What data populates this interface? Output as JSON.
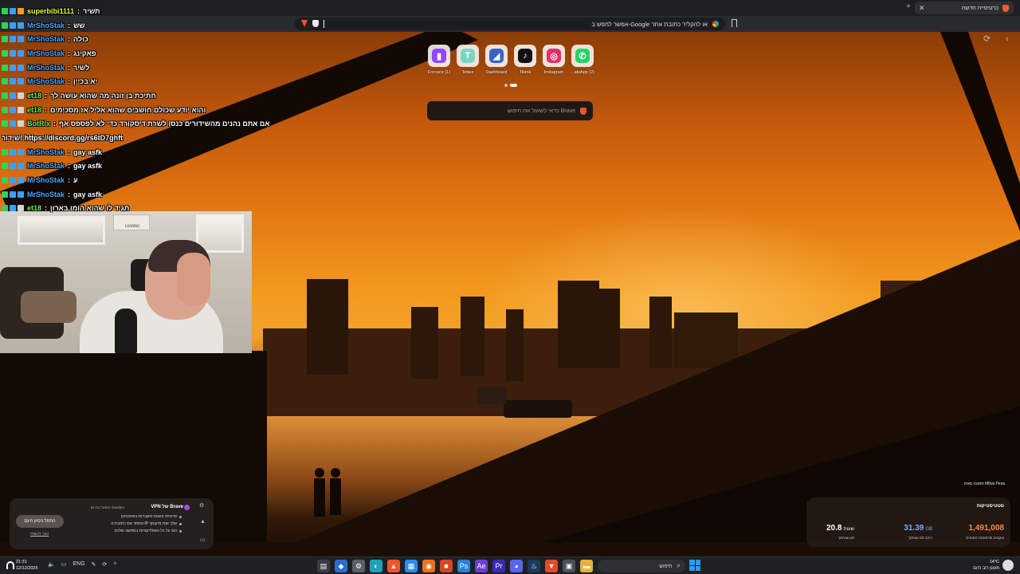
{
  "browser": {
    "tab_title": "כרטיסייה חדשה",
    "address_placeholder": "אפשר לחפש ב-Google או להקליד כתובת אתר"
  },
  "speed_dial": [
    {
      "label": "Forcece (1)",
      "icon": "twitch-icon",
      "color": "#9146ff",
      "glyph": "▮"
    },
    {
      "label": "Tebex",
      "icon": "tebex-icon",
      "color": "#7fd3c4",
      "glyph": "T"
    },
    {
      "label": "Dashboard",
      "icon": "dashboard-icon",
      "color": "#3a63c8",
      "glyph": "◢"
    },
    {
      "label": "Tiktok",
      "icon": "tiktok-icon",
      "color": "#111111",
      "glyph": "♪"
    },
    {
      "label": "Instagram",
      "icon": "instagram-icon",
      "color": "#e1306c",
      "glyph": "◎"
    },
    {
      "label": "...atsApp (2)",
      "icon": "whatsapp-icon",
      "color": "#25d366",
      "glyph": "✆"
    }
  ],
  "ai_search_placeholder": "כדאי לשאול את חיפוש Brave",
  "chat": [
    {
      "user": "superbibi1111",
      "user_class": "yellow",
      "msg": "תשיר",
      "badges": [
        "green",
        "blue",
        "orange"
      ]
    },
    {
      "user": "MrShoStak",
      "user_class": "",
      "msg": "שש",
      "badges": [
        "green",
        "blue",
        "blue"
      ]
    },
    {
      "user": "MrShoStak",
      "user_class": "",
      "msg": "כולה",
      "badges": [
        "green",
        "blue",
        "blue"
      ]
    },
    {
      "user": "MrShoStak",
      "user_class": "",
      "msg": "פאקינג",
      "badges": [
        "green",
        "blue",
        "blue"
      ]
    },
    {
      "user": "MrShoStak",
      "user_class": "",
      "msg": "לשיר",
      "badges": [
        "green",
        "blue",
        "blue"
      ]
    },
    {
      "user": "MrShoStak",
      "user_class": "",
      "msg": "יא בכיין",
      "badges": [
        "green",
        "blue",
        "blue"
      ]
    },
    {
      "user": "et18",
      "user_class": "bot",
      "msg": "חתיכת בן זונה מה שהוא עושה לך",
      "badges": [
        "green",
        "blue",
        "gray"
      ]
    },
    {
      "user": "et18",
      "user_class": "bot",
      "msg": "והוא יודע שכולם חושבים שהוא אליל אז מסכימים",
      "badges": [
        "green",
        "blue",
        "gray"
      ]
    },
    {
      "user": "BotRix",
      "user_class": "bot",
      "msg": "אם אתם נהנים מהשידורים כנסו לשרת דיסקורד כדי לא לפספס אף",
      "badges": [
        "green",
        "blue",
        "gray"
      ]
    },
    {
      "user": "",
      "user_class": "",
      "msg": "שידור! https://discord.gg/rs6tD7ghft",
      "badges": []
    },
    {
      "user": "MrShoStak",
      "user_class": "",
      "msg": "gay asfk",
      "badges": [
        "green",
        "blue",
        "blue"
      ]
    },
    {
      "user": "MrShoStak",
      "user_class": "",
      "msg": "gay asfk",
      "badges": [
        "green",
        "blue",
        "blue"
      ]
    },
    {
      "user": "MrShoStak",
      "user_class": "",
      "msg": "ע",
      "badges": [
        "green",
        "blue",
        "blue"
      ]
    },
    {
      "user": "MrShoStak",
      "user_class": "",
      "msg": "gay asfk",
      "badges": [
        "green",
        "blue",
        "blue"
      ]
    },
    {
      "user": "et18",
      "user_class": "bot",
      "msg": "תגיד לו שהוא הומו בארון",
      "badges": [
        "green",
        "blue",
        "gray"
      ]
    }
  ],
  "webcam": {
    "sign_text": "LOADING"
  },
  "vpn_card": {
    "title": "VPN של Brave",
    "subtitle": "מופעל בחינם Sweden",
    "bullets": [
      "פרטיות והגנות מוגברות באינטרנט",
      "הסתר את כתובת ה-IP שלך ואת מיקומך",
      "הגנ על כל האפליקציות במחשב שלכם"
    ],
    "button": "התחל ניסיון חינם",
    "link": "כבר רכשתי"
  },
  "photo_credit": "תמונה מאת Mihai Pexa",
  "stats": {
    "title": "סטטיסטיקות",
    "items": [
      {
        "value": "1,491,008",
        "unit": "",
        "label": "עוקבים ופרסומות חסומים",
        "color": "#ff8a3a"
      },
      {
        "value": "31.39",
        "unit": "GB",
        "label": "רוחב פס שנחסך",
        "color": "#7ea6ff"
      },
      {
        "value": "20.8",
        "unit": "שעות",
        "label": "זמן שנחסך",
        "color": "#ffffff"
      }
    ]
  },
  "taskbar": {
    "time": "21:31",
    "date": "12/12/2025",
    "lang": "ENG",
    "search_label": "חיפוש",
    "weather_temp": "14°C",
    "weather_desc": "מעונן רוב היום"
  }
}
